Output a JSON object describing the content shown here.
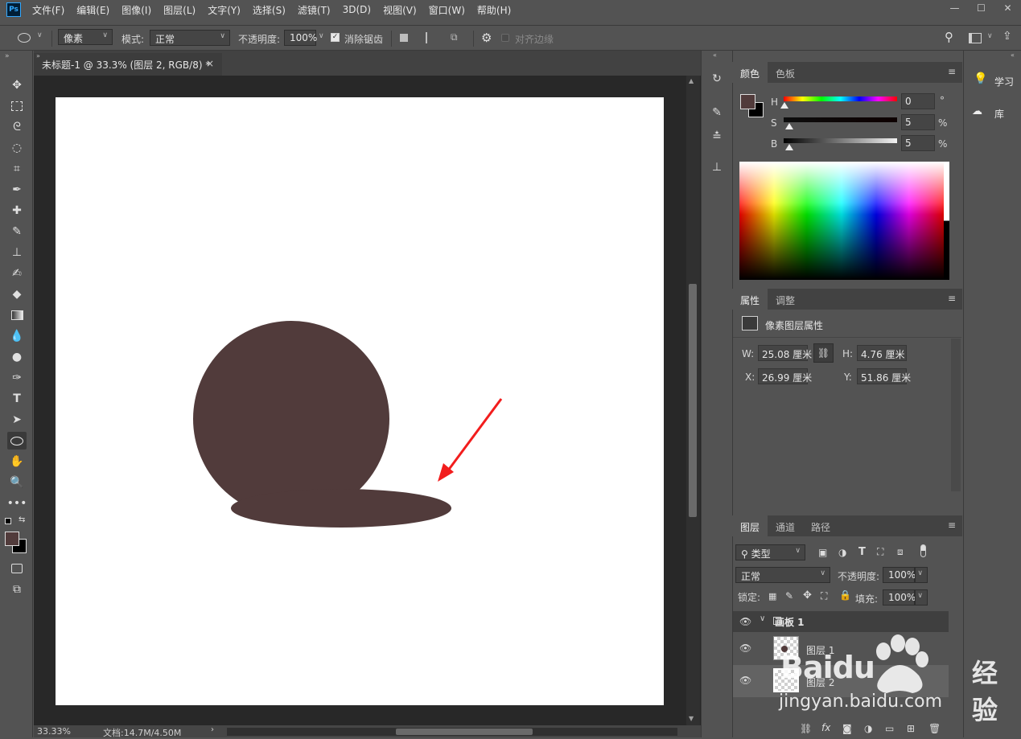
{
  "app": {
    "logo": "Ps"
  },
  "menu": [
    "文件(F)",
    "编辑(E)",
    "图像(I)",
    "图层(L)",
    "文字(Y)",
    "选择(S)",
    "滤镜(T)",
    "3D(D)",
    "视图(V)",
    "窗口(W)",
    "帮助(H)"
  ],
  "window_controls": {
    "minimize": "—",
    "maximize": "☐",
    "close": "✕"
  },
  "options": {
    "shape_mode": "像素",
    "mode_label": "模式:",
    "mode_value": "正常",
    "opacity_label": "不透明度:",
    "opacity_value": "100%",
    "antialias_label": "消除锯齿",
    "align_edges_label": "对齐边缘"
  },
  "document": {
    "tab_title": "未标题-1 @ 33.3% (图层 2, RGB/8) *",
    "tab_close": "×",
    "zoom": "33.33%",
    "doc_info": "文档:14.7M/4.50M"
  },
  "color_panel": {
    "tabs": [
      "颜色",
      "色板"
    ],
    "h_label": "H",
    "h_value": "0",
    "h_unit": "°",
    "s_label": "S",
    "s_value": "5",
    "s_unit": "%",
    "b_label": "B",
    "b_value": "5",
    "b_unit": "%",
    "foreground": "#513b3b",
    "background": "#000000"
  },
  "properties_panel": {
    "tabs": [
      "属性",
      "调整"
    ],
    "title": "像素图层属性",
    "w_label": "W:",
    "w_value": "25.08 厘米",
    "h_label": "H:",
    "h_value": "4.76 厘米",
    "x_label": "X:",
    "x_value": "26.99 厘米",
    "y_label": "Y:",
    "y_value": "51.86 厘米"
  },
  "layers_panel": {
    "tabs": [
      "图层",
      "通道",
      "路径"
    ],
    "filter_label": "类型",
    "blend_mode": "正常",
    "opacity_label": "不透明度:",
    "opacity_value": "100%",
    "lock_label": "锁定:",
    "fill_label": "填充:",
    "fill_value": "100%",
    "group_name": "画板 1",
    "layers": [
      {
        "name": "图层 1"
      },
      {
        "name": "图层 2"
      }
    ]
  },
  "learn_panel": {
    "learn": "学习",
    "library": "库"
  },
  "watermark": {
    "brand": "Baidu",
    "cn": "经验",
    "url": "jingyan.baidu.com"
  },
  "shape_color": "#513b3b",
  "arrow_color": "#f21d1d"
}
